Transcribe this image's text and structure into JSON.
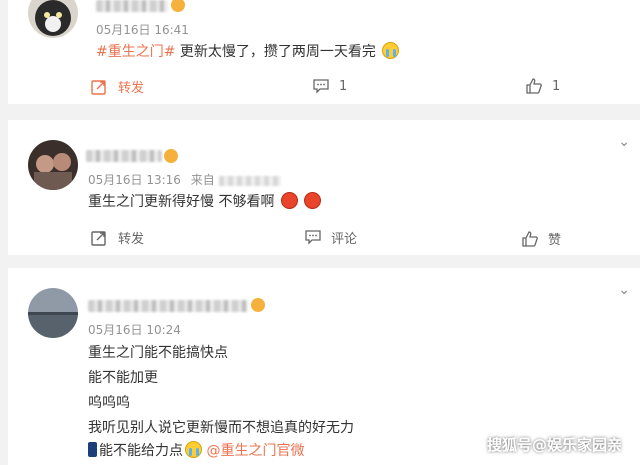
{
  "comments": [
    {
      "time": "05月16日 16:41",
      "topic": "#重生之门#",
      "text": "更新太慢了，攒了两周一天看完",
      "emoji": "cry-emoji",
      "repost_label": "转发",
      "comment_count": "1",
      "like_count": "1"
    },
    {
      "time": "05月16日 13:16",
      "source_prefix": "来自",
      "text": "重生之门更新得好慢 不够看啊",
      "emojis": [
        "angry-emoji",
        "angry-emoji"
      ],
      "repost_label": "转发",
      "comment_label": "评论",
      "like_label": "赞"
    },
    {
      "time": "05月16日 10:24",
      "lines": [
        "重生之门能不能搞快点",
        "能不能加更",
        "呜呜呜",
        "我听见别人说它更新慢而不想追真的好无力"
      ],
      "last_line_text": "能不能给力点",
      "last_line_mention": "@重生之门官微"
    }
  ],
  "watermark": "搜狐号@娱乐家园亲",
  "colors": {
    "accent": "#eb7350",
    "background": "#f2f2f2",
    "card": "#ffffff"
  }
}
